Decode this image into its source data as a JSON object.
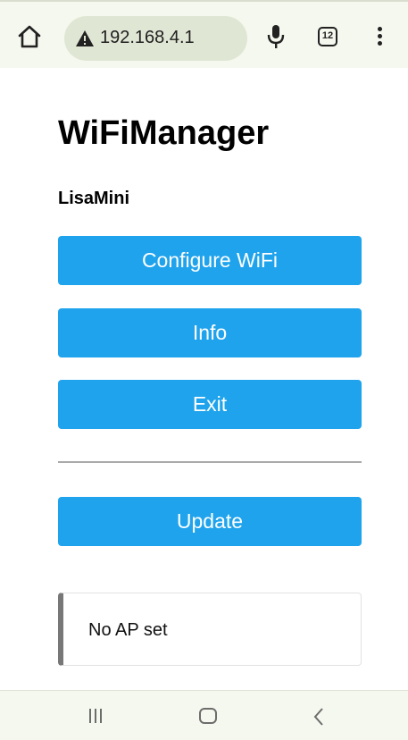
{
  "browser": {
    "url": "192.168.4.1",
    "tab_count": "12"
  },
  "page": {
    "title": "WiFiManager",
    "subtitle": "LisaMini",
    "buttons": {
      "configure": "Configure WiFi",
      "info": "Info",
      "exit": "Exit",
      "update": "Update"
    },
    "message": "No AP set"
  },
  "colors": {
    "button": "#1fa3ec",
    "browser_bar": "#f5f8ee",
    "url_pill": "#e0e6d4",
    "message_accent": "#777777"
  },
  "icons": {
    "home": "home-icon",
    "warning": "warning-icon",
    "mic": "microphone-icon",
    "tabs": "tabs-icon",
    "menu": "more-vert-icon",
    "recents": "recents-icon",
    "nav_home": "nav-home-icon",
    "back": "back-icon"
  }
}
